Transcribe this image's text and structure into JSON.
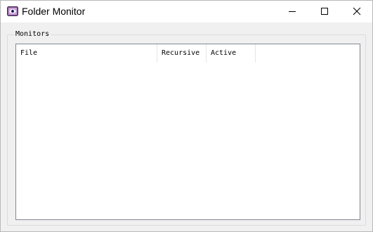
{
  "window": {
    "title": "Folder Monitor",
    "icon": "folder-monitor-app-icon",
    "controls": {
      "minimize_icon": "minimize-icon",
      "maximize_icon": "maximize-icon",
      "close_icon": "close-icon"
    }
  },
  "group": {
    "label": "Monitors"
  },
  "list": {
    "columns": [
      "File",
      "Recursive",
      "Active"
    ],
    "rows": []
  },
  "colors": {
    "titlebar": "#ffffff",
    "window_bg": "#f0f0f0",
    "list_border": "#828790"
  }
}
